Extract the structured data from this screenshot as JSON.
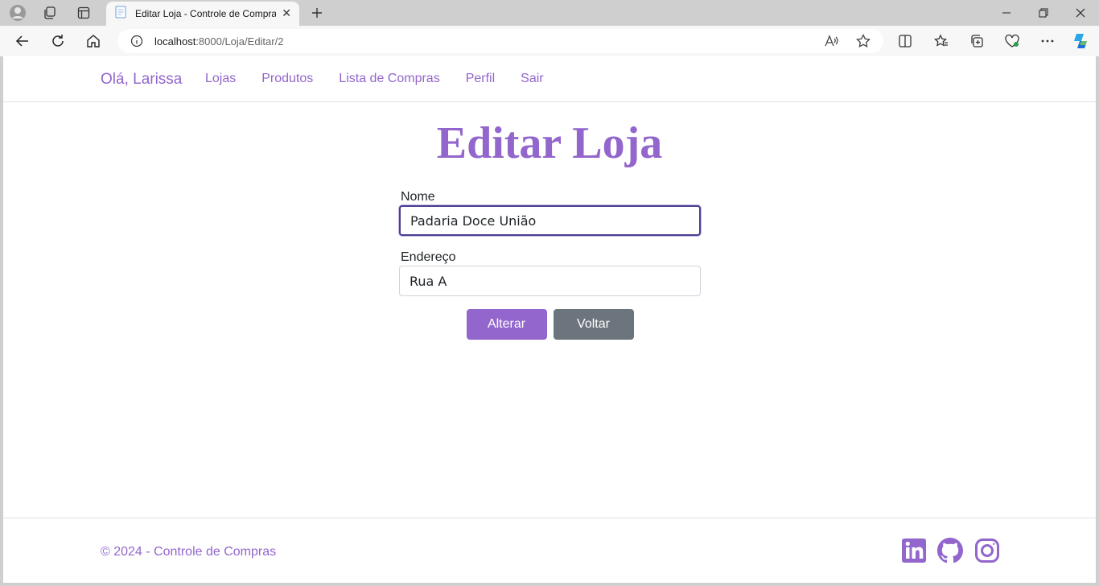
{
  "browser": {
    "tab_title": "Editar Loja - Controle de Compras",
    "url_host": "localhost",
    "url_rest": ":8000/Loja/Editar/2"
  },
  "nav": {
    "brand": "Olá, Larissa",
    "links": [
      "Lojas",
      "Produtos",
      "Lista de Compras",
      "Perfil",
      "Sair"
    ]
  },
  "page": {
    "title": "Editar Loja"
  },
  "form": {
    "nome_label": "Nome",
    "nome_value": "Padaria Doce União",
    "endereco_label": "Endereço",
    "endereco_value": "Rua A",
    "submit_label": "Alterar",
    "back_label": "Voltar"
  },
  "footer": {
    "copyright": "© 2024 - Controle de Compras",
    "social_icons": [
      "linkedin-icon",
      "github-icon",
      "instagram-icon"
    ]
  },
  "colors": {
    "accent": "#9266cc",
    "secondary": "#6c757d",
    "focus_border": "#4c3d8f"
  }
}
